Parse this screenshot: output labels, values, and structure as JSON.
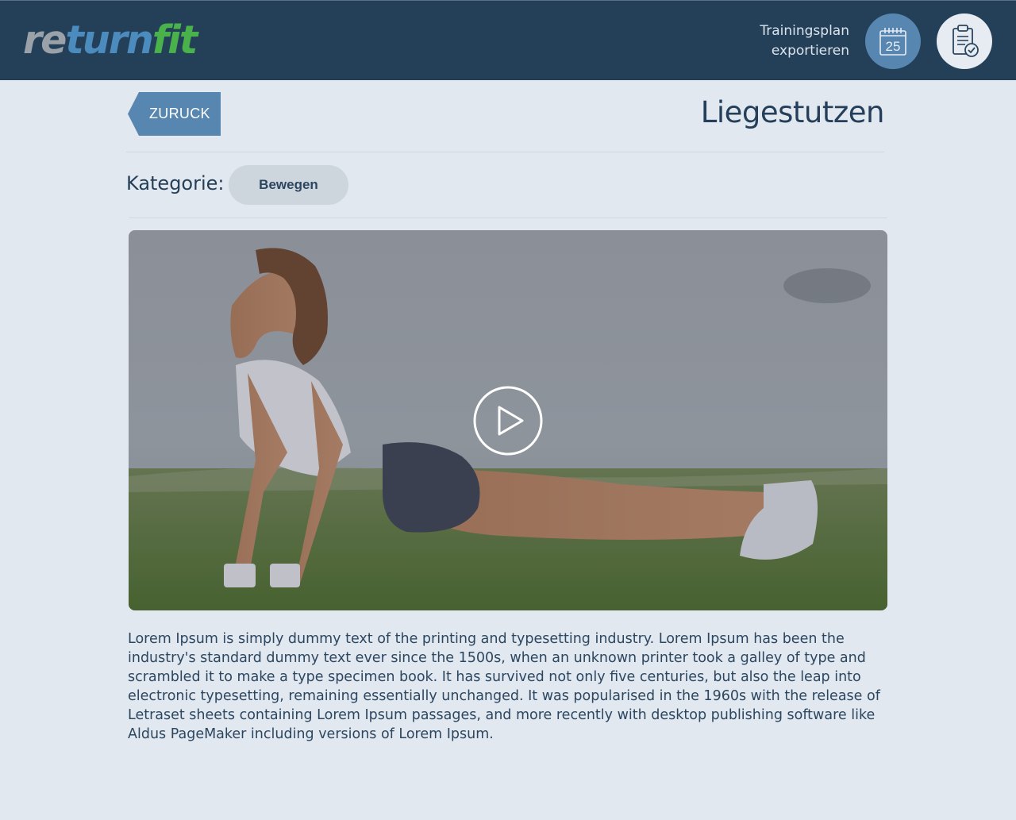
{
  "header": {
    "logo": {
      "part1": "re",
      "part2": "turn",
      "part3": "fit"
    },
    "export_line1": "Trainingsplan",
    "export_line2": "exportieren",
    "calendar_day": "25",
    "icons": {
      "calendar": "calendar-icon",
      "plan": "clipboard-check-icon"
    }
  },
  "nav": {
    "back_label": "ZURUCK"
  },
  "exercise": {
    "title": "Liegestutzen",
    "category_label": "Kategorie:",
    "category_value": "Bewegen"
  },
  "video": {
    "play_icon": "play-icon"
  },
  "description": "Lorem Ipsum is simply dummy text of the printing and typesetting industry. Lorem Ipsum has been the industry's standard dummy text ever since the 1500s, when an unknown printer took a galley of type and scrambled it to make a type specimen book. It has survived not only five centuries, but also the leap into electronic typesetting, remaining essentially unchanged. It was popularised in the 1960s with the release of Letraset sheets containing Lorem Ipsum passages, and more recently with desktop publishing software like Aldus PageMaker including versions of Lorem Ipsum.",
  "colors": {
    "header_bg": "#244059",
    "page_bg": "#e1e8ef",
    "accent_blue": "#5787b0",
    "brand_green": "#49b24a"
  }
}
